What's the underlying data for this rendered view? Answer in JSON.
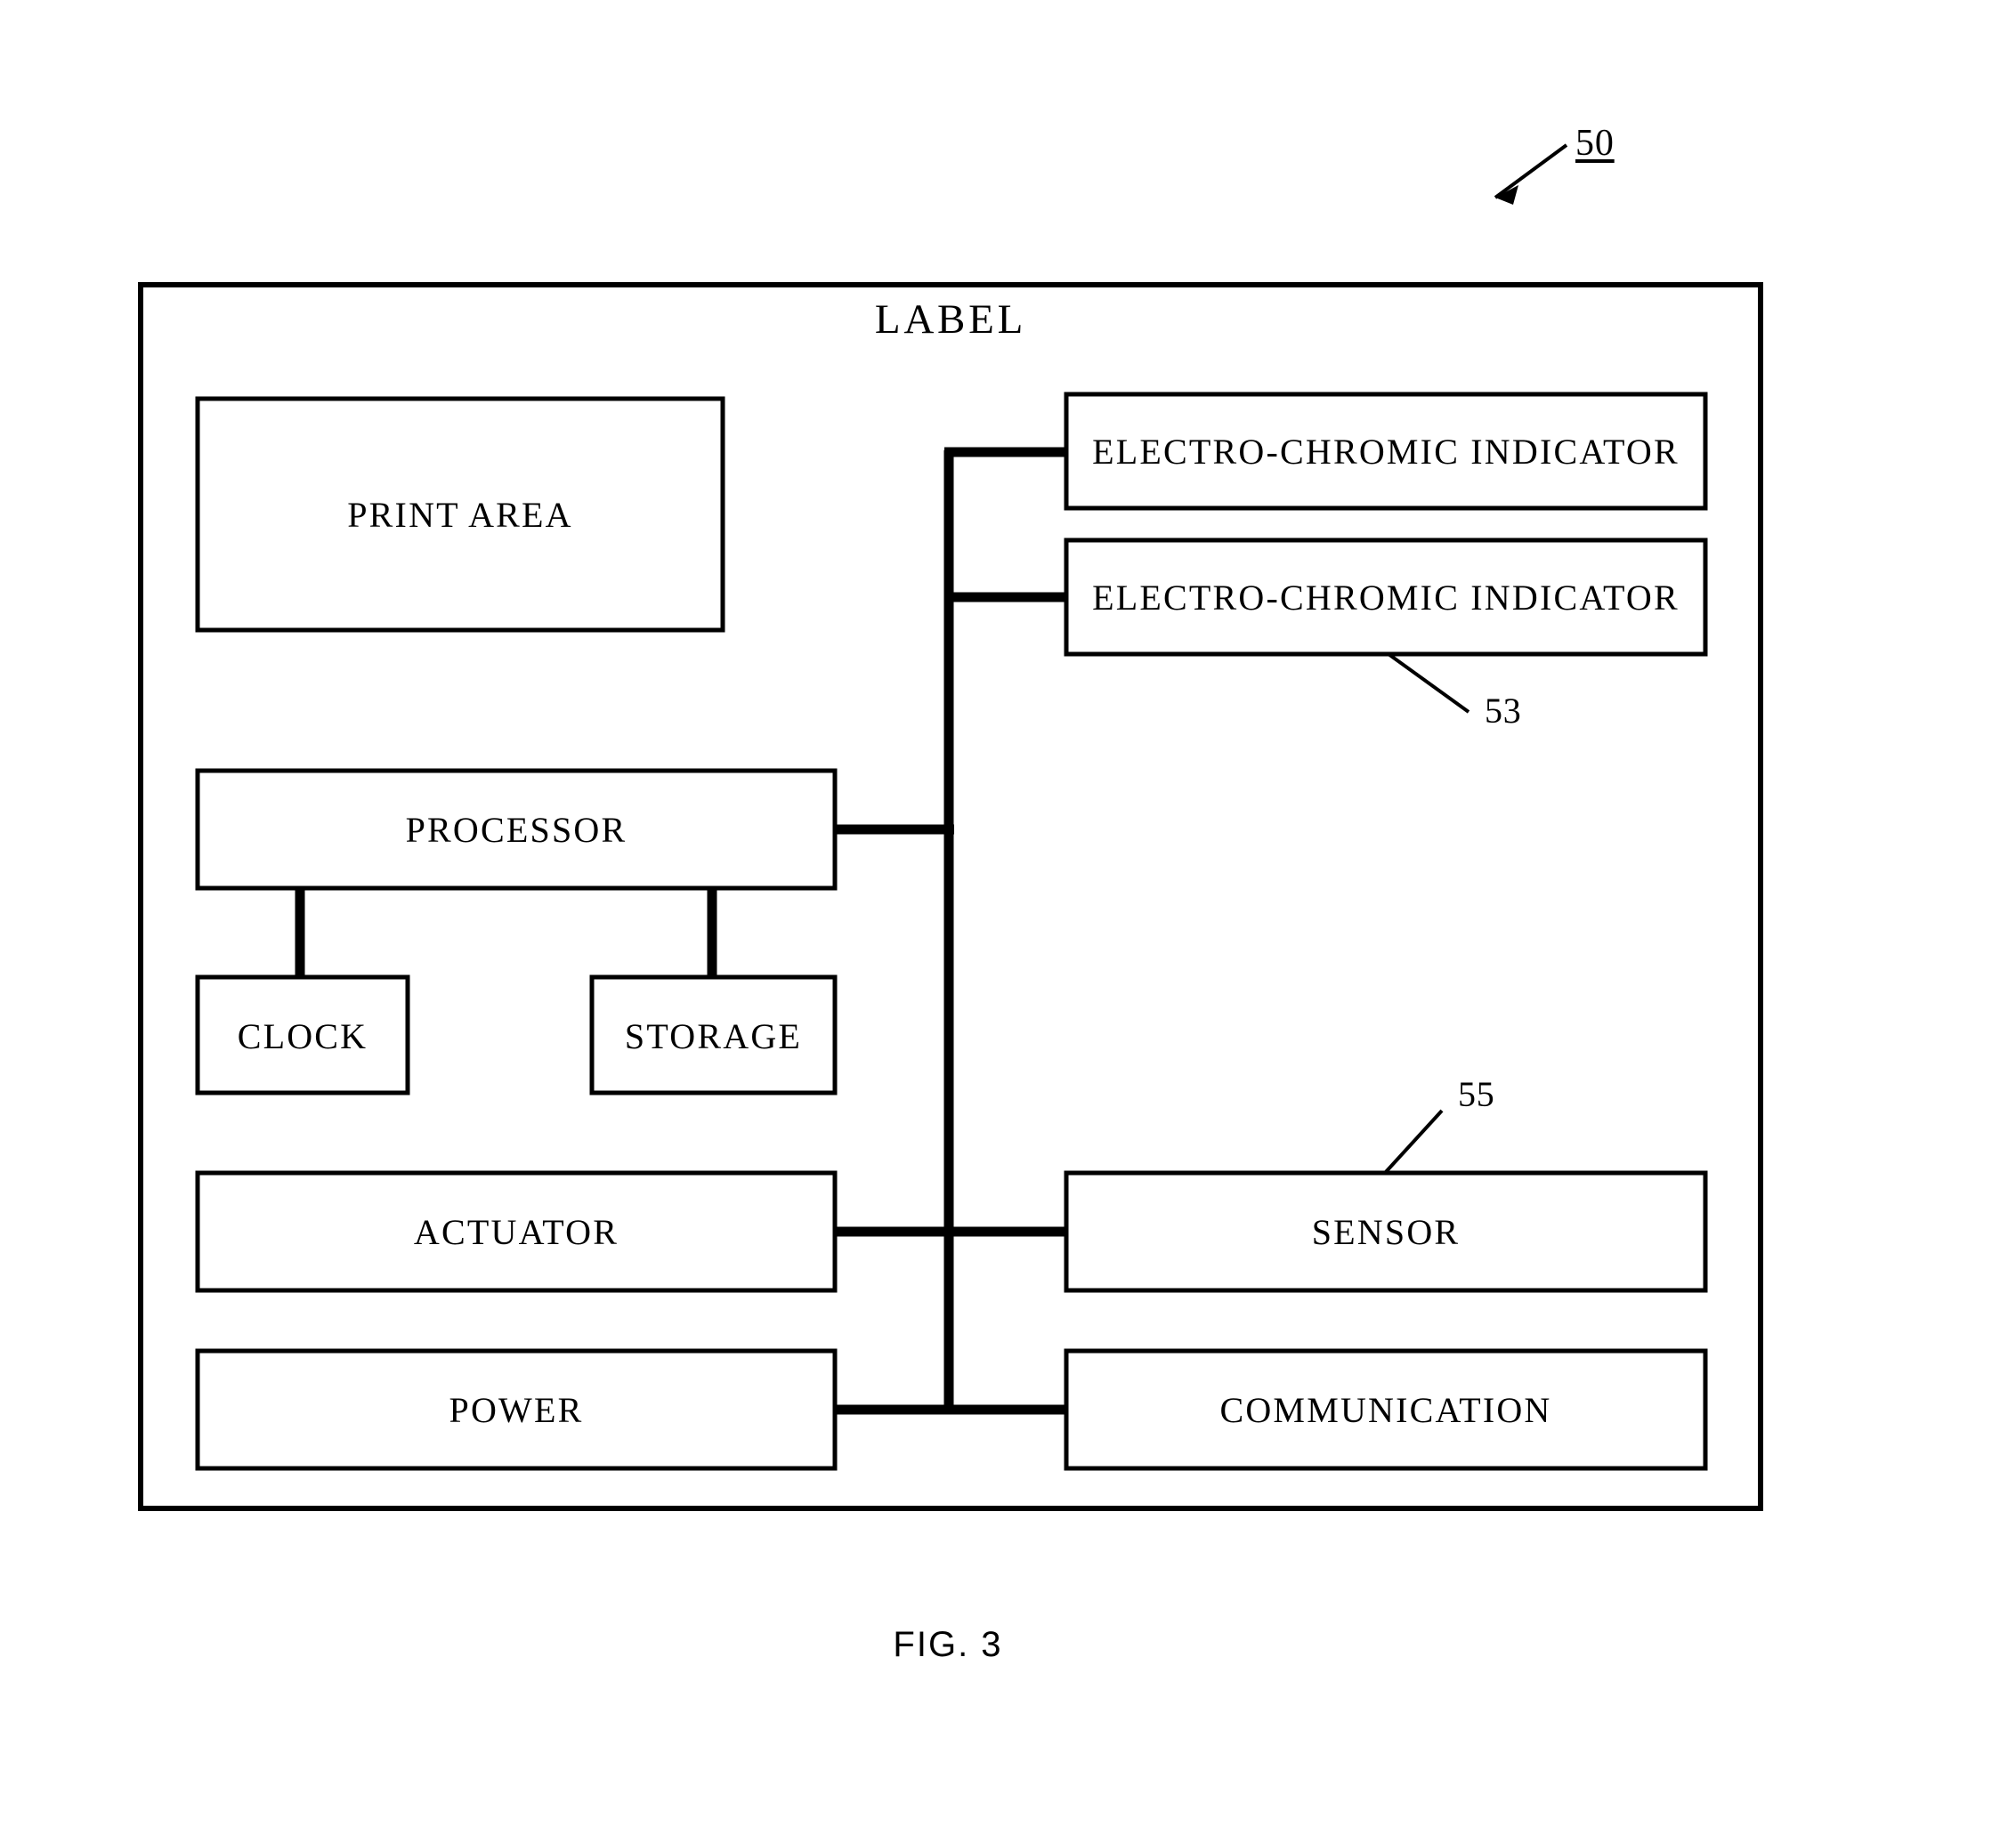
{
  "figure": {
    "caption": "FIG. 3",
    "outer_reference_numeral": "50",
    "outer_box_title": "LABEL"
  },
  "blocks": {
    "print_area": "PRINT AREA",
    "processor": "PROCESSOR",
    "clock": "CLOCK",
    "storage": "STORAGE",
    "actuator": "ACTUATOR",
    "power": "POWER",
    "indicator_1": "ELECTRO-CHROMIC INDICATOR",
    "indicator_2": "ELECTRO-CHROMIC INDICATOR",
    "sensor": "SENSOR",
    "communication": "COMMUNICATION"
  },
  "reference_numerals": {
    "indicator": "53",
    "sensor": "55"
  },
  "colors": {
    "stroke": "#000000",
    "background": "#ffffff",
    "text": "#000000"
  }
}
